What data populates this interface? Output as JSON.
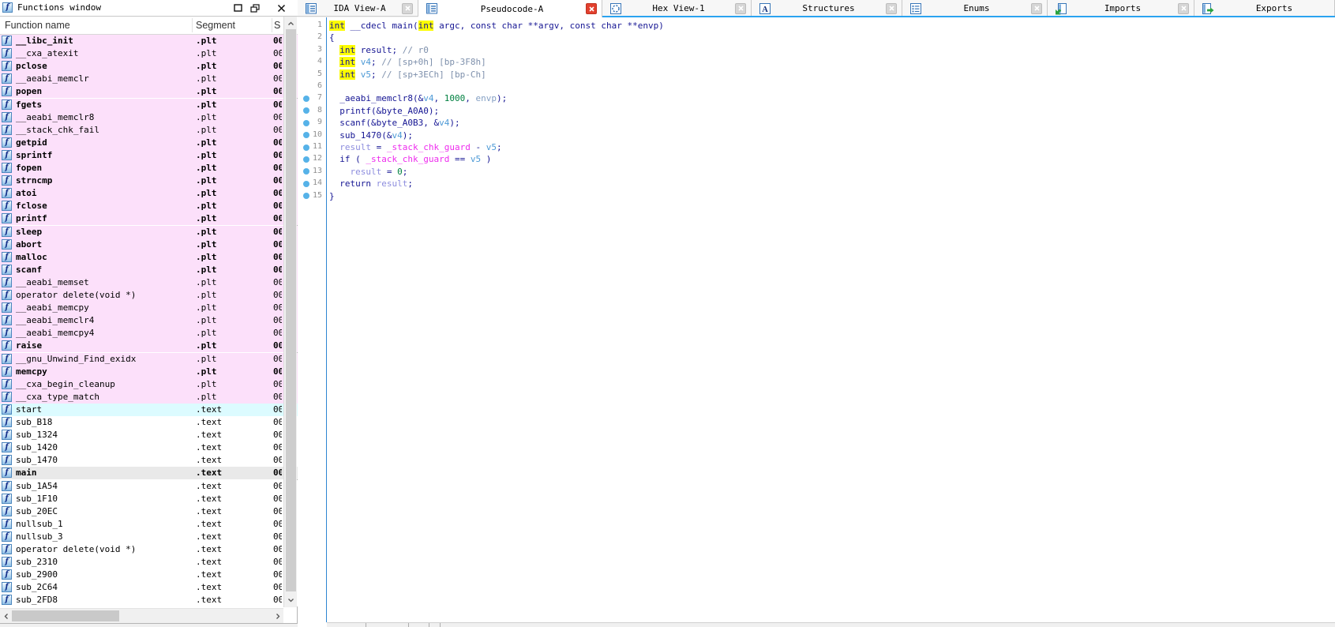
{
  "functions_panel": {
    "title": "Functions window",
    "columns": [
      "Function name",
      "Segment",
      "S"
    ],
    "start_col_value": "00",
    "rows": [
      {
        "name": "__libc_init",
        "segment": ".plt",
        "bold": true,
        "bg": "plt"
      },
      {
        "name": "__cxa_atexit",
        "segment": ".plt",
        "bold": false,
        "bg": "plt"
      },
      {
        "name": "pclose",
        "segment": ".plt",
        "bold": true,
        "bg": "plt"
      },
      {
        "name": "__aeabi_memclr",
        "segment": ".plt",
        "bold": false,
        "bg": "plt"
      },
      {
        "name": "popen",
        "segment": ".plt",
        "bold": true,
        "bg": "plt"
      },
      {
        "name": "fgets",
        "segment": ".plt",
        "bold": true,
        "bg": "plt"
      },
      {
        "name": "__aeabi_memclr8",
        "segment": ".plt",
        "bold": false,
        "bg": "plt"
      },
      {
        "name": "__stack_chk_fail",
        "segment": ".plt",
        "bold": false,
        "bg": "plt"
      },
      {
        "name": "getpid",
        "segment": ".plt",
        "bold": true,
        "bg": "plt"
      },
      {
        "name": "sprintf",
        "segment": ".plt",
        "bold": true,
        "bg": "plt"
      },
      {
        "name": "fopen",
        "segment": ".plt",
        "bold": true,
        "bg": "plt"
      },
      {
        "name": "strncmp",
        "segment": ".plt",
        "bold": true,
        "bg": "plt"
      },
      {
        "name": "atoi",
        "segment": ".plt",
        "bold": true,
        "bg": "plt"
      },
      {
        "name": "fclose",
        "segment": ".plt",
        "bold": true,
        "bg": "plt"
      },
      {
        "name": "printf",
        "segment": ".plt",
        "bold": true,
        "bg": "plt"
      },
      {
        "name": "sleep",
        "segment": ".plt",
        "bold": true,
        "bg": "plt"
      },
      {
        "name": "abort",
        "segment": ".plt",
        "bold": true,
        "bg": "plt"
      },
      {
        "name": "malloc",
        "segment": ".plt",
        "bold": true,
        "bg": "plt"
      },
      {
        "name": "scanf",
        "segment": ".plt",
        "bold": true,
        "bg": "plt"
      },
      {
        "name": "__aeabi_memset",
        "segment": ".plt",
        "bold": false,
        "bg": "plt"
      },
      {
        "name": "operator delete(void *)",
        "segment": ".plt",
        "bold": false,
        "bg": "plt"
      },
      {
        "name": "__aeabi_memcpy",
        "segment": ".plt",
        "bold": false,
        "bg": "plt"
      },
      {
        "name": "__aeabi_memclr4",
        "segment": ".plt",
        "bold": false,
        "bg": "plt"
      },
      {
        "name": "__aeabi_memcpy4",
        "segment": ".plt",
        "bold": false,
        "bg": "plt"
      },
      {
        "name": "raise",
        "segment": ".plt",
        "bold": true,
        "bg": "plt"
      },
      {
        "name": "__gnu_Unwind_Find_exidx",
        "segment": ".plt",
        "bold": false,
        "bg": "plt"
      },
      {
        "name": "memcpy",
        "segment": ".plt",
        "bold": true,
        "bg": "plt"
      },
      {
        "name": "__cxa_begin_cleanup",
        "segment": ".plt",
        "bold": false,
        "bg": "plt"
      },
      {
        "name": "__cxa_type_match",
        "segment": ".plt",
        "bold": false,
        "bg": "plt"
      },
      {
        "name": "start",
        "segment": ".text",
        "bold": false,
        "bg": "start"
      },
      {
        "name": "sub_B18",
        "segment": ".text",
        "bold": false,
        "bg": "text"
      },
      {
        "name": "sub_1324",
        "segment": ".text",
        "bold": false,
        "bg": "text"
      },
      {
        "name": "sub_1420",
        "segment": ".text",
        "bold": false,
        "bg": "text"
      },
      {
        "name": "sub_1470",
        "segment": ".text",
        "bold": false,
        "bg": "text"
      },
      {
        "name": "main",
        "segment": ".text",
        "bold": true,
        "bg": "selected"
      },
      {
        "name": "sub_1A54",
        "segment": ".text",
        "bold": false,
        "bg": "text"
      },
      {
        "name": "sub_1F10",
        "segment": ".text",
        "bold": false,
        "bg": "text"
      },
      {
        "name": "sub_20EC",
        "segment": ".text",
        "bold": false,
        "bg": "text"
      },
      {
        "name": "nullsub_1",
        "segment": ".text",
        "bold": false,
        "bg": "text"
      },
      {
        "name": "nullsub_3",
        "segment": ".text",
        "bold": false,
        "bg": "text"
      },
      {
        "name": "operator delete(void *)",
        "segment": ".text",
        "bold": false,
        "bg": "text"
      },
      {
        "name": "sub_2310",
        "segment": ".text",
        "bold": false,
        "bg": "text"
      },
      {
        "name": "sub_2900",
        "segment": ".text",
        "bold": false,
        "bg": "text"
      },
      {
        "name": "sub_2C64",
        "segment": ".text",
        "bold": false,
        "bg": "text"
      },
      {
        "name": "sub_2FD8",
        "segment": ".text",
        "bold": false,
        "bg": "text"
      }
    ]
  },
  "tabs": [
    {
      "label": "IDA View-A",
      "icon": "disassembly-view-icon",
      "close": "gray",
      "active": false
    },
    {
      "label": "Pseudocode-A",
      "icon": "pseudocode-view-icon",
      "close": "red",
      "active": true
    },
    {
      "label": "Hex View-1",
      "icon": "hex-view-icon",
      "close": "gray",
      "active": false
    },
    {
      "label": "Structures",
      "icon": "structures-icon",
      "close": "gray",
      "active": false
    },
    {
      "label": "Enums",
      "icon": "enums-icon",
      "close": "gray",
      "active": false
    },
    {
      "label": "Imports",
      "icon": "imports-icon",
      "close": "gray",
      "active": false
    },
    {
      "label": "Exports",
      "icon": "exports-icon",
      "close": "none",
      "active": false
    }
  ],
  "pseudocode": {
    "lines": [
      {
        "n": 1,
        "dot": false,
        "toks": [
          [
            "hl",
            "int"
          ],
          [
            "k",
            " __cdecl main("
          ],
          [
            "hl",
            "int"
          ],
          [
            "k",
            " argc, const char **argv, const char **envp)"
          ]
        ]
      },
      {
        "n": 2,
        "dot": false,
        "toks": [
          [
            "k",
            "{"
          ]
        ]
      },
      {
        "n": 3,
        "dot": false,
        "toks": [
          [
            "k",
            "  "
          ],
          [
            "hl",
            "int"
          ],
          [
            "k",
            " result; "
          ],
          [
            "c",
            "// r0"
          ]
        ]
      },
      {
        "n": 4,
        "dot": false,
        "toks": [
          [
            "k",
            "  "
          ],
          [
            "hl",
            "int"
          ],
          [
            "k",
            " "
          ],
          [
            "v",
            "v4"
          ],
          [
            "k",
            "; "
          ],
          [
            "c",
            "// [sp+0h] [bp-3F8h]"
          ]
        ]
      },
      {
        "n": 5,
        "dot": false,
        "toks": [
          [
            "k",
            "  "
          ],
          [
            "hl",
            "int"
          ],
          [
            "k",
            " "
          ],
          [
            "v",
            "v5"
          ],
          [
            "k",
            "; "
          ],
          [
            "c",
            "// [sp+3ECh] [bp-Ch]"
          ]
        ]
      },
      {
        "n": 6,
        "dot": false,
        "toks": []
      },
      {
        "n": 7,
        "dot": true,
        "toks": [
          [
            "k",
            "  _aeabi_memclr8(&"
          ],
          [
            "v",
            "v4"
          ],
          [
            "k",
            ", "
          ],
          [
            "g",
            "1000"
          ],
          [
            "k",
            ", "
          ],
          [
            "e",
            "envp"
          ],
          [
            "k",
            ");"
          ]
        ]
      },
      {
        "n": 8,
        "dot": true,
        "toks": [
          [
            "k",
            "  printf(&byte_A0A0);"
          ]
        ]
      },
      {
        "n": 9,
        "dot": true,
        "toks": [
          [
            "k",
            "  scanf(&byte_A0B3, &"
          ],
          [
            "v",
            "v4"
          ],
          [
            "k",
            ");"
          ]
        ]
      },
      {
        "n": 10,
        "dot": true,
        "toks": [
          [
            "k",
            "  sub_1470(&"
          ],
          [
            "v",
            "v4"
          ],
          [
            "k",
            ");"
          ]
        ]
      },
      {
        "n": 11,
        "dot": true,
        "toks": [
          [
            "k",
            "  "
          ],
          [
            "r",
            "result"
          ],
          [
            "k",
            " = "
          ],
          [
            "m",
            "_stack_chk_guard"
          ],
          [
            "k",
            " - "
          ],
          [
            "v",
            "v5"
          ],
          [
            "k",
            ";"
          ]
        ]
      },
      {
        "n": 12,
        "dot": true,
        "toks": [
          [
            "k",
            "  if ( "
          ],
          [
            "m",
            "_stack_chk_guard"
          ],
          [
            "k",
            " == "
          ],
          [
            "v",
            "v5"
          ],
          [
            "k",
            " )"
          ]
        ]
      },
      {
        "n": 13,
        "dot": true,
        "toks": [
          [
            "k",
            "    "
          ],
          [
            "r",
            "result"
          ],
          [
            "k",
            " = "
          ],
          [
            "g",
            "0"
          ],
          [
            "k",
            ";"
          ]
        ]
      },
      {
        "n": 14,
        "dot": true,
        "toks": [
          [
            "k",
            "  return "
          ],
          [
            "r",
            "result"
          ],
          [
            "k",
            ";"
          ]
        ]
      },
      {
        "n": 15,
        "dot": true,
        "toks": [
          [
            "k",
            "}"
          ]
        ]
      }
    ]
  },
  "colors": {
    "keyword_navy": "#151593",
    "variable_blue": "#4d9ad6",
    "result_lavender": "#8d8dde",
    "guard_magenta": "#ee2bee",
    "number_green": "#008040",
    "comment_gray_blue": "#7e90ac",
    "argument_slate": "#85a0c4",
    "word_highlight_yellow": "#fcfc00",
    "plt_row_pink": "#fce0fa",
    "start_row_cyan": "#dcfbff",
    "selected_row_gray": "#e9e9e9",
    "tab_accent_blue": "#2aa3f0",
    "address_dot_blue": "#56b2e8",
    "tab_close_red": "#e2402e"
  }
}
